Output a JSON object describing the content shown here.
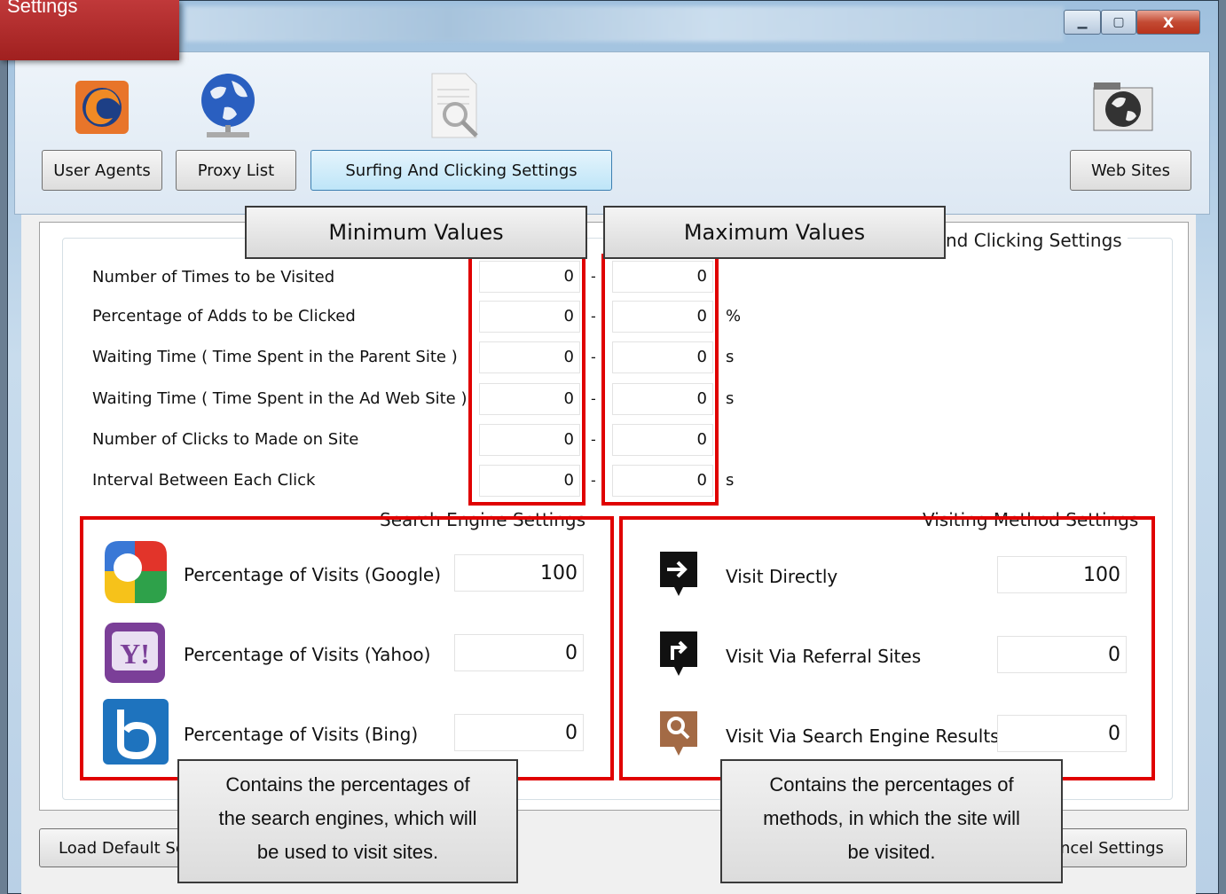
{
  "corner_label": "Settings",
  "window": {
    "buttons": {
      "minimize": "▁",
      "maximize": "▢",
      "close": "X"
    }
  },
  "toolbar": {
    "user_agents": "User Agents",
    "proxy_list": "Proxy List",
    "surfing": "Surfing And Clicking Settings",
    "web_sites": "Web Sites",
    "icons": [
      "firefox-icon",
      "globe-network-icon",
      "document-search-icon",
      "globe-drive-icon"
    ]
  },
  "group_title": "nd Clicking Settings",
  "rows": [
    {
      "label": "Number of Times to be Visited",
      "min": "0",
      "max": "0",
      "unit": ""
    },
    {
      "label": "Percentage of Adds to be Clicked",
      "min": "0",
      "max": "0",
      "unit": "%"
    },
    {
      "label": "Waiting Time ( Time Spent in the Parent Site )",
      "min": "0",
      "max": "0",
      "unit": "s"
    },
    {
      "label": "Waiting Time ( Time Spent in the Ad Web Site )",
      "min": "0",
      "max": "0",
      "unit": "s"
    },
    {
      "label": "Number of Clicks to Made on Site",
      "min": "0",
      "max": "0",
      "unit": ""
    },
    {
      "label": "Interval Between Each Click",
      "min": "0",
      "max": "0",
      "unit": "s"
    }
  ],
  "dash": "-",
  "search_engine": {
    "title": "Search Engine Settings",
    "items": [
      {
        "label": "Percentage of Visits (Google)",
        "value": "100",
        "icon": "google-icon"
      },
      {
        "label": "Percentage of Visits (Yahoo)",
        "value": "0",
        "icon": "yahoo-icon"
      },
      {
        "label": "Percentage of Visits (Bing)",
        "value": "0",
        "icon": "bing-icon"
      }
    ]
  },
  "visiting_method": {
    "title": "Visiting Method Settings",
    "items": [
      {
        "label": "Visit Directly",
        "value": "100",
        "icon": "arrow-right-icon"
      },
      {
        "label": "Visit Via Referral Sites",
        "value": "0",
        "icon": "arrow-turn-icon"
      },
      {
        "label": "Visit Via Search Engine Results",
        "value": "0",
        "icon": "magnifier-icon"
      }
    ]
  },
  "callouts": {
    "min": "Minimum Values",
    "max": "Maximum Values",
    "search_note": [
      "Contains the percentages of",
      "the search engines, which will",
      "be used to visit sites."
    ],
    "method_note": [
      "Contains the percentages of",
      "methods, in which the site will",
      "be visited."
    ]
  },
  "bottom": {
    "load_default": "Load Default Se",
    "cancel": "ncel Settings"
  },
  "colors": {
    "highlight_red": "#e00000",
    "corner_red": "#b02a2a",
    "yahoo_purple": "#7b3f98",
    "bing_blue": "#1e73be"
  }
}
